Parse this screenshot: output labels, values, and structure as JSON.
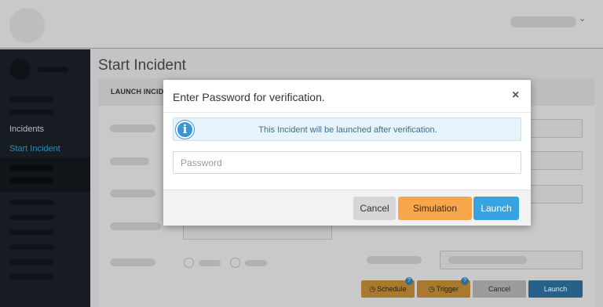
{
  "sidebar": {
    "items": [
      {
        "label": "Incidents"
      },
      {
        "label": "Start Incident",
        "active": true
      }
    ]
  },
  "page": {
    "title": "Start Incident",
    "panel_header": "LAUNCH INCIDE"
  },
  "background_buttons": {
    "schedule": "Schedule",
    "trigger": "Trigger",
    "cancel": "Cancel",
    "launch": "Launch",
    "help_glyph": "?"
  },
  "modal": {
    "title": "Enter Password for verification.",
    "close_glyph": "×",
    "info_glyph": "i",
    "info_text": "This Incident will be launched after verification.",
    "password_placeholder": "Password",
    "password_value": "",
    "buttons": {
      "cancel": "Cancel",
      "simulation": "Simulation",
      "launch": "Launch"
    }
  },
  "colors": {
    "accent_blue": "#37a3e0",
    "simulation_orange": "#f7a74a",
    "info_bg": "#e7f3fa",
    "sidebar_active": "#2a8ab8"
  },
  "icons": [
    "user-avatar-icon",
    "chevron-down-icon",
    "info-icon",
    "close-icon",
    "clock-icon",
    "help-icon"
  ]
}
